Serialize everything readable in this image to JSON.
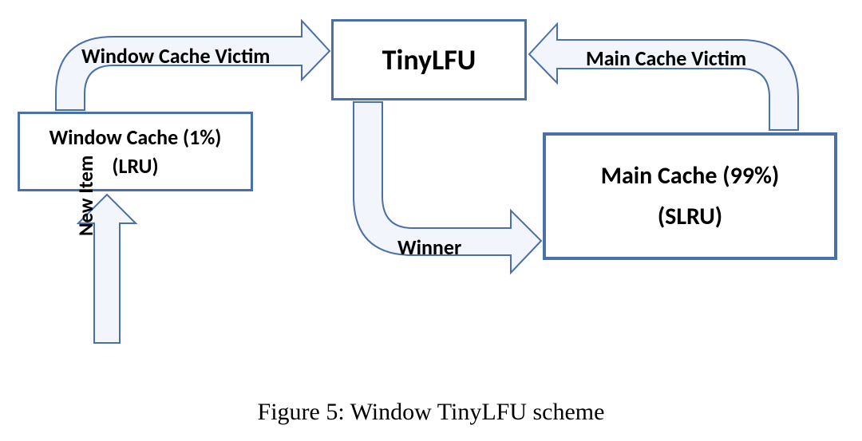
{
  "diagram": {
    "boxes": {
      "window_cache": {
        "line1": "Window Cache (1%)",
        "line2": "(LRU)"
      },
      "tinylfu": {
        "line1": "TinyLFU"
      },
      "main_cache": {
        "line1": "Main Cache (99%)",
        "line2": "(SLRU)"
      }
    },
    "arrows": {
      "window_victim": {
        "label": "Window Cache Victim"
      },
      "main_victim": {
        "label": "Main Cache Victim"
      },
      "winner": {
        "label": "Winner"
      },
      "new_item": {
        "label": "New Item"
      }
    },
    "colors": {
      "stroke": "#4a70a8",
      "arrow_fill": "#f2f5fb"
    }
  },
  "caption": "Figure 5: Window TinyLFU scheme"
}
